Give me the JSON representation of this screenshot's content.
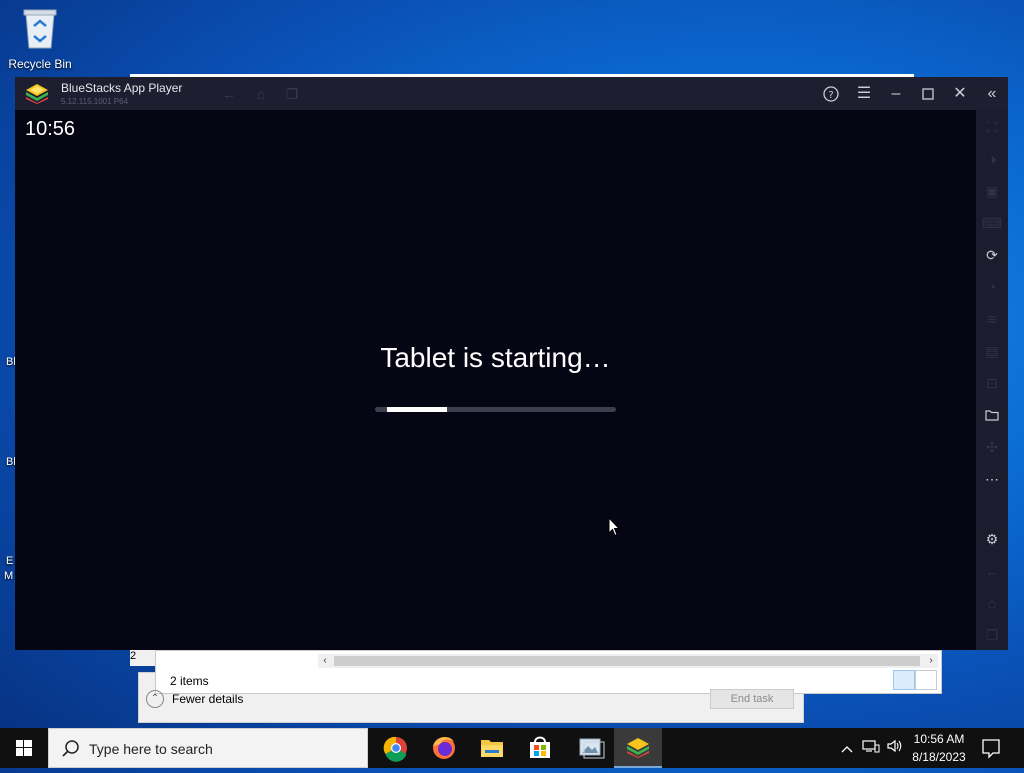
{
  "desktop": {
    "recycle_bin_label": "Recycle Bin",
    "edge_labels": [
      "Bl",
      "Bl",
      "E",
      "M"
    ]
  },
  "background_windows": {
    "explorer_items": "2 items",
    "explorer_partial": "2",
    "fewer_details": "Fewer details",
    "end_task": "End task"
  },
  "bluestacks": {
    "title": "BlueStacks App Player",
    "version": "5.12.115.1001 P64",
    "screen": {
      "clock": "10:56",
      "status_text": "Tablet is starting…",
      "progress": {
        "start": 0.05,
        "end": 0.3
      }
    },
    "titlebar_icons": [
      "back-icon",
      "home-icon",
      "multitask-icon",
      "help-icon",
      "menu-icon",
      "minimize-icon",
      "maximize-icon",
      "close-icon",
      "collapse-sidebar-icon"
    ],
    "sidebar_icons": [
      "fullscreen-icon",
      "volume-icon",
      "display-icon",
      "keyboard-icon",
      "macro-icon",
      "rotate-icon",
      "shake-icon",
      "apk-icon",
      "screenshot-icon",
      "folder-icon",
      "location-icon",
      "more-icon",
      "settings-icon",
      "back-icon",
      "home-icon",
      "recent-apps-icon"
    ]
  },
  "taskbar": {
    "search_placeholder": "Type here to search",
    "apps": [
      "Chrome",
      "Firefox",
      "File Explorer",
      "Microsoft Store",
      "Image Viewer",
      "BlueStacks"
    ],
    "active_app": "BlueStacks",
    "time": "10:56 AM",
    "date": "8/18/2023"
  },
  "colors": {
    "bs_screen": "#050514",
    "bs_chrome": "#1b1d2e",
    "taskbar": "#101010",
    "accent": "#7aa7d8"
  }
}
